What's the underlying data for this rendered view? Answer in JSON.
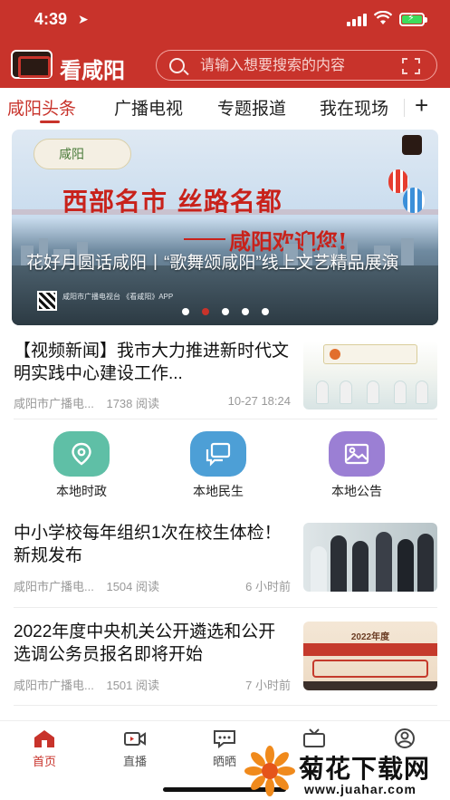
{
  "status_bar": {
    "time": "4:39"
  },
  "header": {
    "app_name": "看咸阳",
    "search_placeholder": "请输入想要搜索的内容"
  },
  "tabs": [
    {
      "label": "咸阳头条",
      "active": true
    },
    {
      "label": "广播电视",
      "active": false
    },
    {
      "label": "专题报道",
      "active": false
    },
    {
      "label": "我在现场",
      "active": false
    }
  ],
  "tab_add_label": "+",
  "banner": {
    "headline": "西部名市 丝路名都",
    "sub": "咸阳欢迎您!",
    "caption": "花好月圆话咸阳丨“歌舞颂咸阳”线上文艺精品展演",
    "qr_text": "咸阳市广播电视台 《看咸阳》APP",
    "dots_count": 5,
    "active_dot_index": 1
  },
  "news": [
    {
      "title": "【视频新闻】我市大力推进新时代文明实践中心建设工作...",
      "source": "咸阳市广播电...",
      "reads": "1738 阅读",
      "time": "10-27 18:24"
    },
    {
      "title": "中小学校每年组织1次在校生体检！新规发布",
      "source": "咸阳市广播电...",
      "reads": "1504 阅读",
      "time": "6 小时前"
    },
    {
      "title": "2022年度中央机关公开遴选和公开选调公务员报名即将开始",
      "source": "咸阳市广播电...",
      "reads": "1501 阅读",
      "time": "7 小时前",
      "thumb_year": "2022年度"
    }
  ],
  "quick_links": [
    {
      "label": "本地时政",
      "icon": "location-pin-icon",
      "color": "#5fbfa6"
    },
    {
      "label": "本地民生",
      "icon": "chat-bubbles-icon",
      "color": "#4d9fd6"
    },
    {
      "label": "本地公告",
      "icon": "image-icon",
      "color": "#9b7fd4"
    }
  ],
  "bottom_nav": [
    {
      "label": "首页",
      "icon": "home-icon",
      "active": true
    },
    {
      "label": "直播",
      "icon": "video-camera-icon",
      "active": false
    },
    {
      "label": "晒晒",
      "icon": "message-icon",
      "active": false
    },
    {
      "label": "",
      "icon": "tv-icon",
      "active": false
    },
    {
      "label": "",
      "icon": "user-icon",
      "active": false
    }
  ],
  "watermark": {
    "title": "菊花下载网",
    "url": "www.juahar.com"
  },
  "colors": {
    "brand_red": "#c8332b",
    "text": "#111111",
    "meta": "#999999"
  }
}
